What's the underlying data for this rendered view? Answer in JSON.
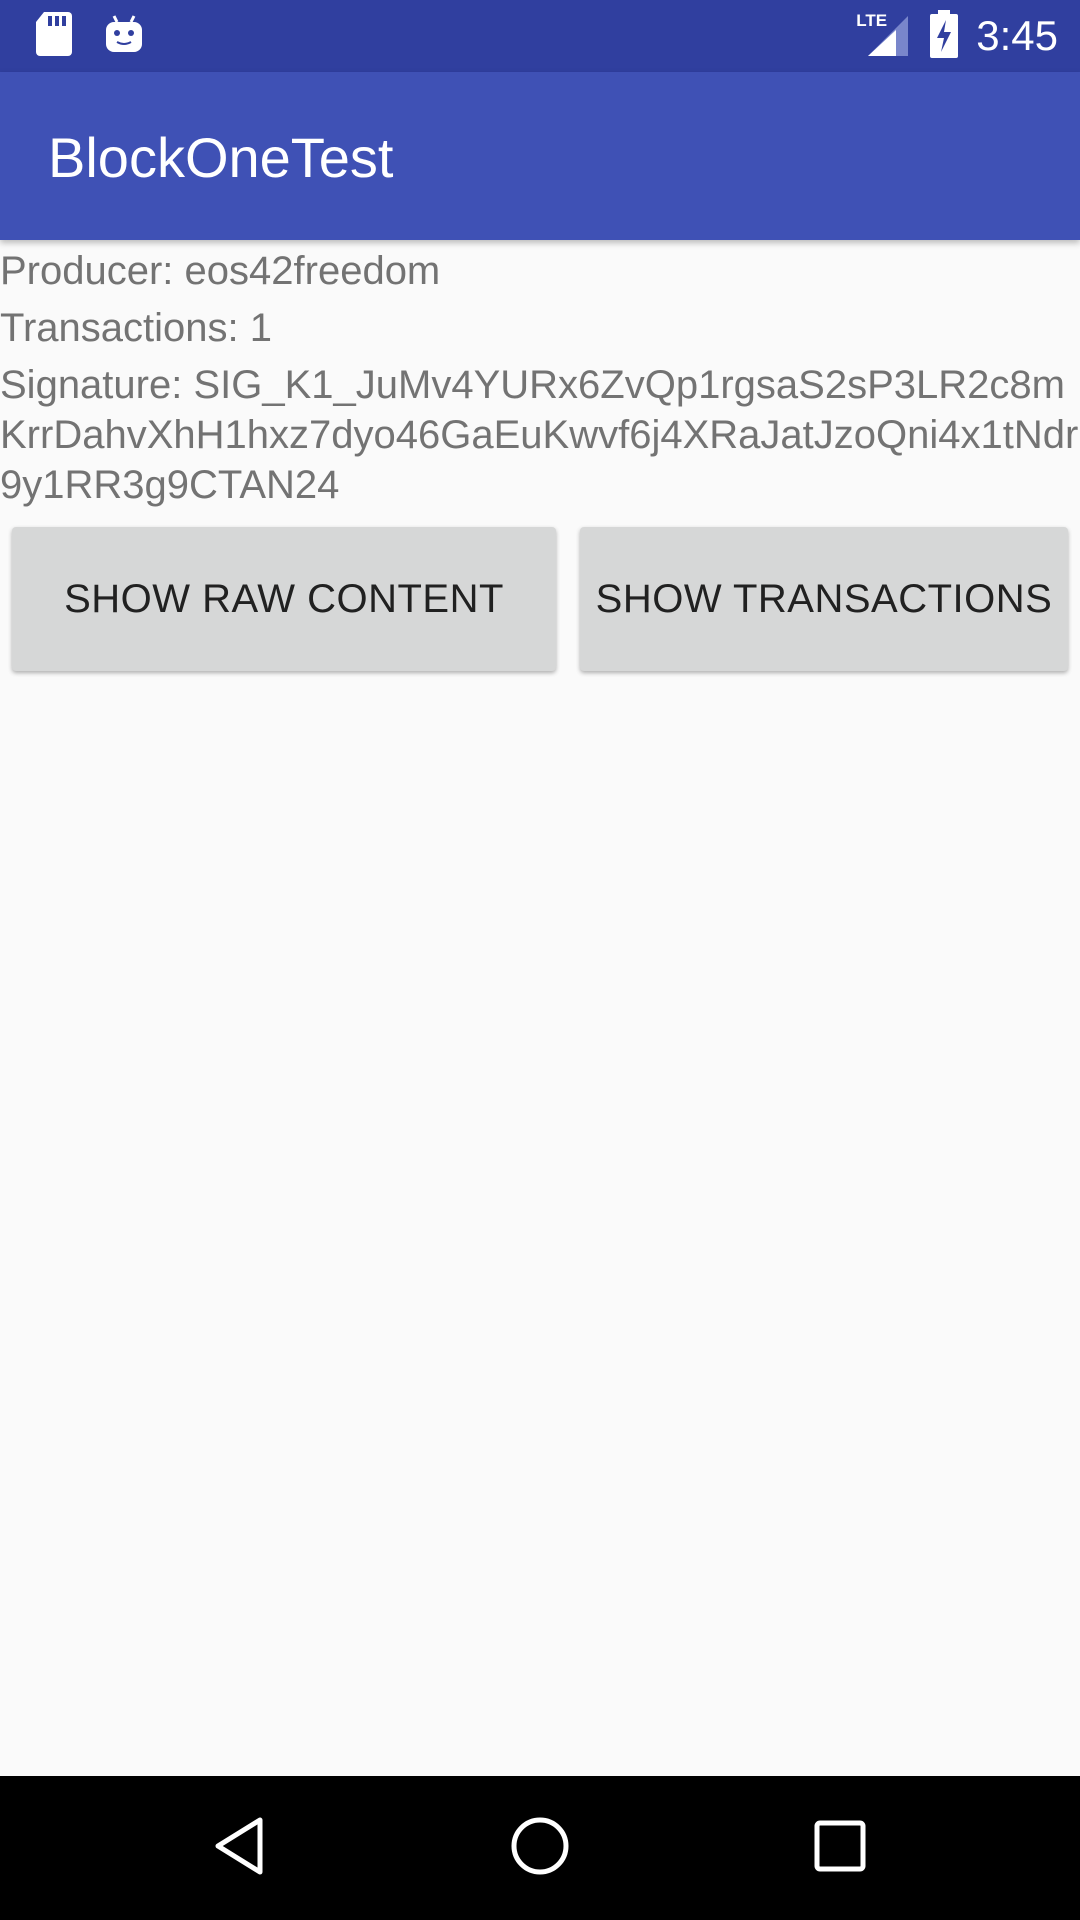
{
  "status_bar": {
    "time": "3:45",
    "network_label": "LTE",
    "icons": [
      "sd-card-icon",
      "android-debug-icon",
      "lte-signal-icon",
      "battery-charging-icon"
    ]
  },
  "app_bar": {
    "title": "BlockOneTest"
  },
  "block_info": {
    "producer": "Producer: eos42freedom",
    "transactions": "Transactions: 1",
    "signature": "Signature: SIG_K1_JuMv4YURx6ZvQp1rgsaS2sP3LR2c8mKrrDahvXhH1hxz7dyo46GaEuKwvf6j4XRaJatJzoQni4x1tNdr9y1RR3g9CTAN24"
  },
  "actions": {
    "show_raw_label": "SHOW RAW CONTENT",
    "show_transactions_label": "SHOW TRANSACTIONS"
  },
  "nav_bar": {
    "icons": [
      "back-icon",
      "home-icon",
      "recents-icon"
    ]
  },
  "colors": {
    "status_bar": "#303f9f",
    "app_bar": "#3f51b5",
    "background": "#fafafa",
    "button": "#d6d7d7",
    "text_secondary": "#737373"
  }
}
